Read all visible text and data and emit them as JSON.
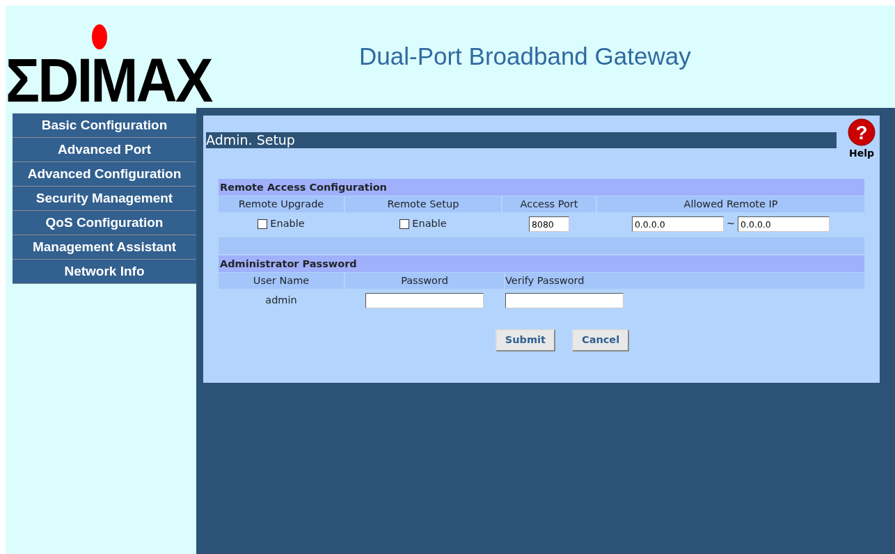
{
  "header": {
    "logo": "ΣDIMAX",
    "title": "Dual-Port Broadband Gateway"
  },
  "sidebar": {
    "items": [
      {
        "label": "Basic Configuration",
        "selected": false
      },
      {
        "label": "Advanced Port",
        "selected": false
      },
      {
        "label": "Advanced Configuration",
        "selected": false
      },
      {
        "label": "Security Management",
        "selected": false
      },
      {
        "label": "QoS Configuration",
        "selected": false
      },
      {
        "label": "Management Assistant",
        "selected": false
      },
      {
        "label": "Network Info",
        "selected": false
      }
    ]
  },
  "page": {
    "title": "Admin. Setup",
    "help_glyph": "?",
    "help": "Help"
  },
  "remote_access": {
    "heading": "Remote Access Configuration",
    "columns": [
      "Remote Upgrade",
      "Remote Setup",
      "Access Port",
      "Allowed Remote IP"
    ],
    "remote_upgrade": {
      "label": "Enable",
      "checked": false
    },
    "remote_setup": {
      "label": "Enable",
      "checked": false
    },
    "access_port": "8080",
    "ip_from": "0.0.0.0",
    "separator": "~",
    "ip_to": "0.0.0.0"
  },
  "admin_password": {
    "heading": "Administrator Password",
    "columns": [
      "User Name",
      "Password",
      "Verify Password"
    ],
    "user_name": "admin"
  },
  "buttons": [
    "Submit",
    "Cancel"
  ]
}
